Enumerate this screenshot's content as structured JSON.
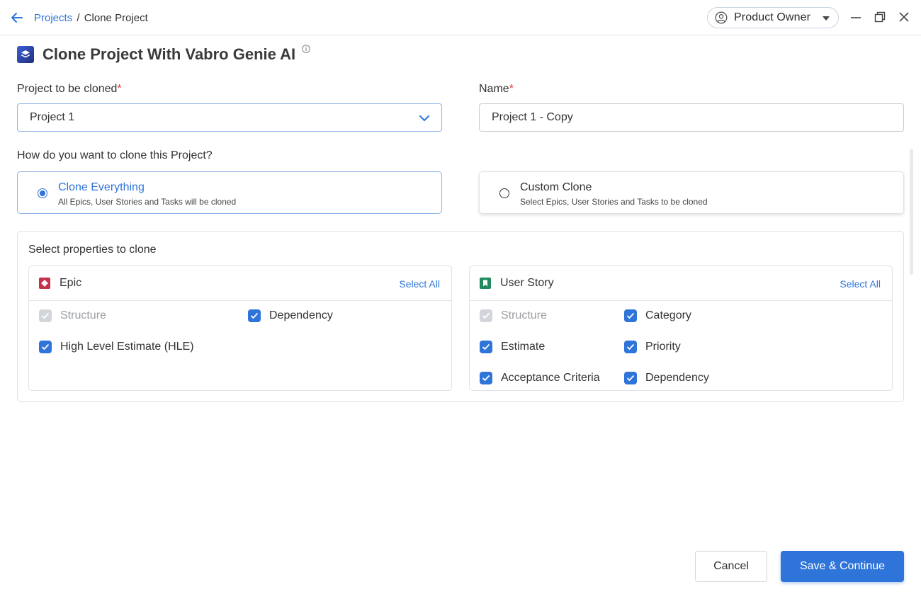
{
  "breadcrumb": {
    "link": "Projects",
    "separator": "/",
    "current": "Clone Project"
  },
  "header": {
    "role": "Product Owner"
  },
  "page": {
    "title": "Clone Project With Vabro Genie AI"
  },
  "form": {
    "project_label": "Project to be cloned",
    "required_mark": "*",
    "project_value": "Project 1",
    "name_label": "Name",
    "name_value": "Project 1 - Copy",
    "question": "How do you want to clone this Project?"
  },
  "options": [
    {
      "title": "Clone Everything",
      "desc": "All Epics, User Stories and Tasks will be cloned",
      "selected": true
    },
    {
      "title": "Custom Clone",
      "desc": "Select Epics, User Stories and Tasks to be cloned",
      "selected": false
    }
  ],
  "properties": {
    "title": "Select properties to clone",
    "select_all": "Select All",
    "epic": {
      "name": "Epic",
      "icon": "epic-icon",
      "color": "#c4314b",
      "items": [
        {
          "label": "Structure",
          "checked": true,
          "disabled": true
        },
        {
          "label": "Dependency",
          "checked": true,
          "disabled": false
        },
        {
          "label": "High Level Estimate (HLE)",
          "checked": true,
          "disabled": false
        }
      ]
    },
    "user_story": {
      "name": "User Story",
      "icon": "user-story-icon",
      "color": "#1f8a5b",
      "items": [
        {
          "label": "Structure",
          "checked": true,
          "disabled": true
        },
        {
          "label": "Category",
          "checked": true,
          "disabled": false
        },
        {
          "label": "Estimate",
          "checked": true,
          "disabled": false
        },
        {
          "label": "Priority",
          "checked": true,
          "disabled": false
        },
        {
          "label": "Acceptance Criteria",
          "checked": true,
          "disabled": false
        },
        {
          "label": "Dependency",
          "checked": true,
          "disabled": false
        }
      ]
    }
  },
  "footer": {
    "cancel": "Cancel",
    "save": "Save & Continue"
  },
  "colors": {
    "accent": "#2f74d9",
    "required": "#e0383e",
    "border": "#dfe2e6"
  }
}
